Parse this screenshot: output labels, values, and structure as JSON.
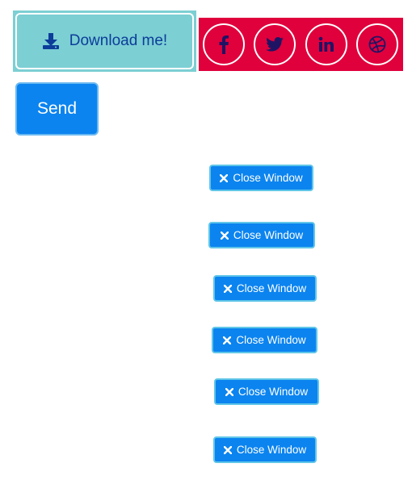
{
  "download": {
    "label": "Download me!",
    "icon": "download-icon"
  },
  "social": {
    "items": [
      {
        "name": "facebook",
        "icon": "facebook-icon"
      },
      {
        "name": "twitter",
        "icon": "twitter-icon"
      },
      {
        "name": "linkedin",
        "icon": "linkedin-icon"
      },
      {
        "name": "dribbble",
        "icon": "dribbble-icon"
      }
    ]
  },
  "send": {
    "label": "Send"
  },
  "close_windows": [
    {
      "label": "Close Window",
      "icon": "close-icon"
    },
    {
      "label": "Close Window",
      "icon": "close-icon"
    },
    {
      "label": "Close Window",
      "icon": "close-icon"
    },
    {
      "label": "Close Window",
      "icon": "close-icon"
    },
    {
      "label": "Close Window",
      "icon": "close-icon"
    },
    {
      "label": "Close Window",
      "icon": "close-icon"
    }
  ],
  "colors": {
    "download_bg": "#7ccfd3",
    "download_text": "#0c3d9a",
    "social_bg": "#e0003c",
    "social_icon": "#1f1464",
    "primary_blue": "#0b84f0",
    "close_border": "#60c6e8"
  }
}
